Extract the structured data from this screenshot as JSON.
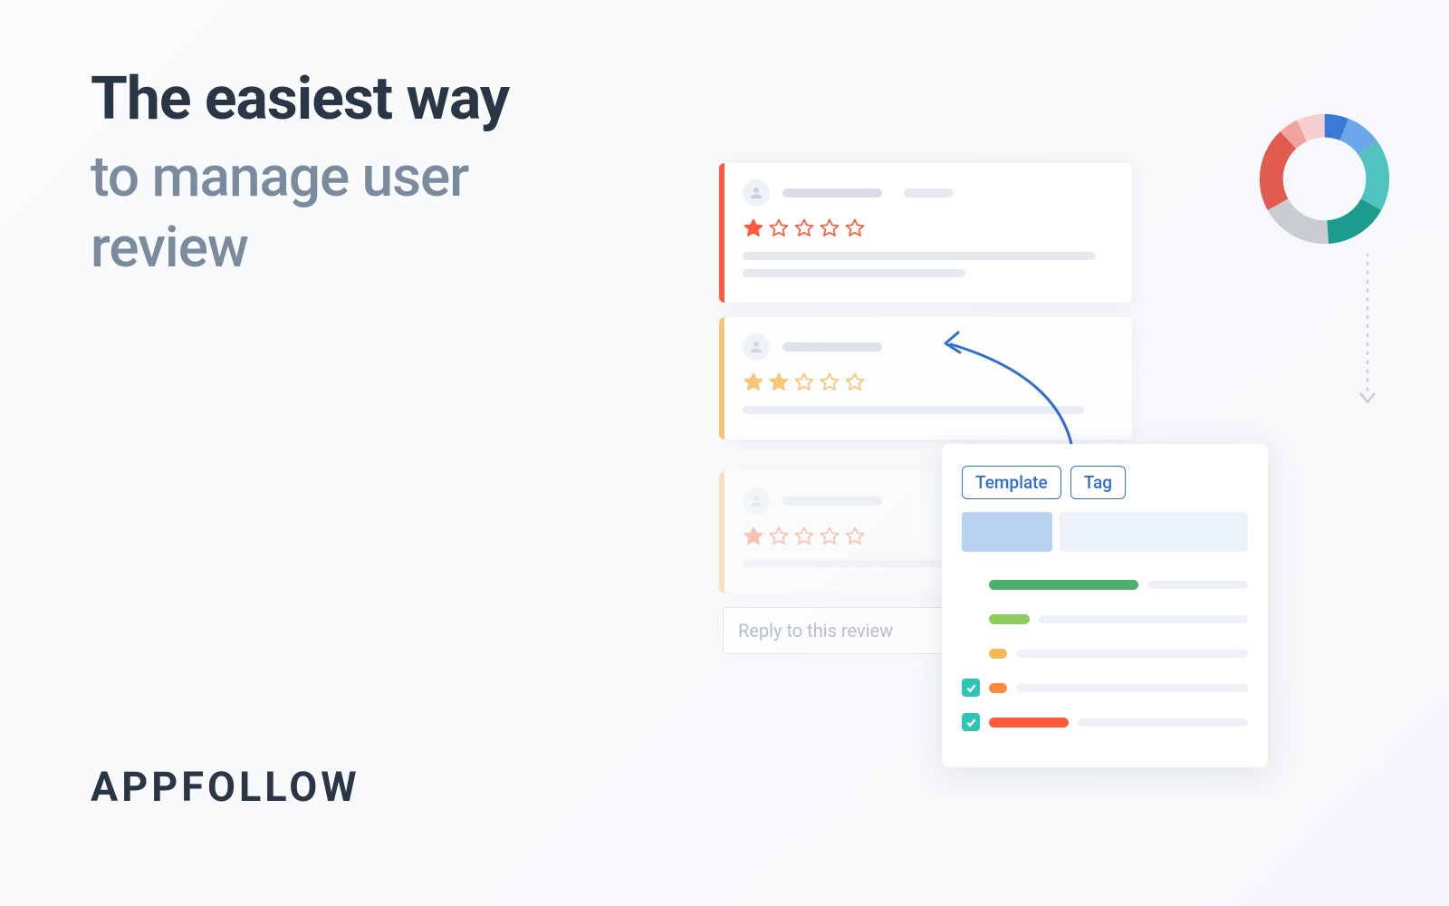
{
  "headline": {
    "line1": "The easiest way",
    "line2": "to manage user review"
  },
  "brand": "APPFOLLOW",
  "reply_placeholder": "Reply to this review",
  "panel": {
    "tab_template": "Template",
    "tab_tag": "Tag"
  },
  "reviews": [
    {
      "rating": 1,
      "accent": "#ff5a3c",
      "star_color": "#ff5a3c"
    },
    {
      "rating": 2,
      "accent": "#f7b955",
      "star_color": "#f7b955"
    },
    {
      "rating": 1,
      "accent": "#f7b955",
      "star_color": "#ff5a3c"
    }
  ],
  "donut_segments": [
    {
      "color": "#3c78d8",
      "pct": 6
    },
    {
      "color": "#6aa7ea",
      "pct": 9
    },
    {
      "color": "#52c2c0",
      "pct": 18
    },
    {
      "color": "#1b9c8f",
      "pct": 16
    },
    {
      "color": "#c9ccd1",
      "pct": 18
    },
    {
      "color": "#e15c4f",
      "pct": 21
    },
    {
      "color": "#f2a3a0",
      "pct": 5
    },
    {
      "color": "#f6d0d0",
      "pct": 7
    }
  ],
  "template_items": [
    {
      "checked": false,
      "pill_color": "#4caf6a",
      "pill_width": 165
    },
    {
      "checked": false,
      "pill_color": "#8bce5e",
      "pill_width": 45
    },
    {
      "checked": false,
      "pill_color": "#f7b955",
      "pill_width": 20
    },
    {
      "checked": true,
      "pill_color": "#ff8a3c",
      "pill_width": 20
    },
    {
      "checked": true,
      "pill_color": "#ff5a3c",
      "pill_width": 88
    }
  ]
}
